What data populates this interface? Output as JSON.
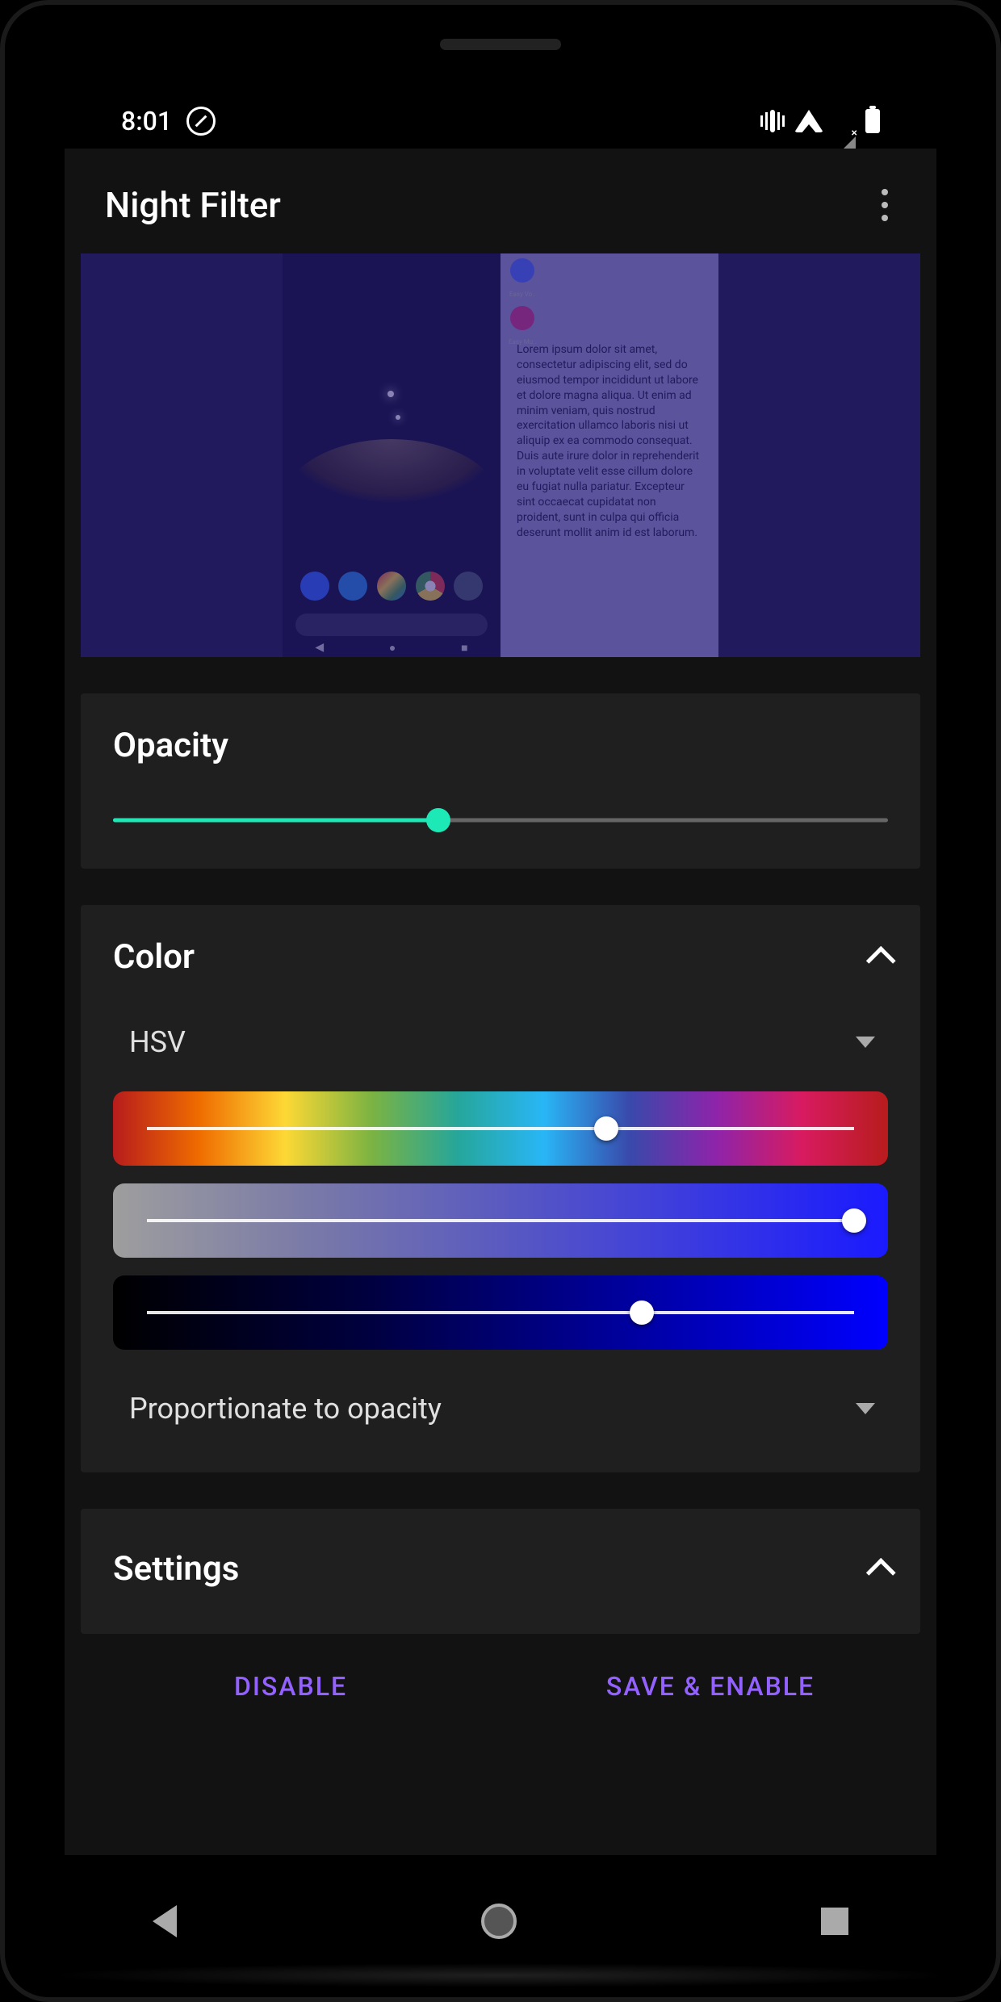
{
  "statusbar": {
    "time": "8:01"
  },
  "header": {
    "title": "Night Filter"
  },
  "preview": {
    "app_icons": [
      "Easy Vo..",
      "Easy Mu.."
    ],
    "lorem": "Lorem ipsum dolor sit amet, consectetur adipiscing elit, sed do eiusmod tempor incididunt ut labore et dolore magna aliqua. Ut enim ad minim veniam, quis nostrud exercitation ullamco laboris nisi ut aliquip ex ea commodo consequat. Duis aute irure dolor in reprehenderit in voluptate velit esse cillum dolore eu fugiat nulla pariatur. Excepteur sint occaecat cupidatat non proident, sunt in culpa qui officia deserunt mollit anim id est laborum."
  },
  "opacity": {
    "title": "Opacity",
    "value_pct": 42
  },
  "color": {
    "title": "Color",
    "mode_label": "HSV",
    "hue_pct": 65,
    "sat_pct": 100,
    "val_pct": 70,
    "opacity_relation_label": "Proportionate to opacity"
  },
  "settings": {
    "title": "Settings"
  },
  "actions": {
    "disable": "DISABLE",
    "save_enable": "SAVE & ENABLE"
  }
}
